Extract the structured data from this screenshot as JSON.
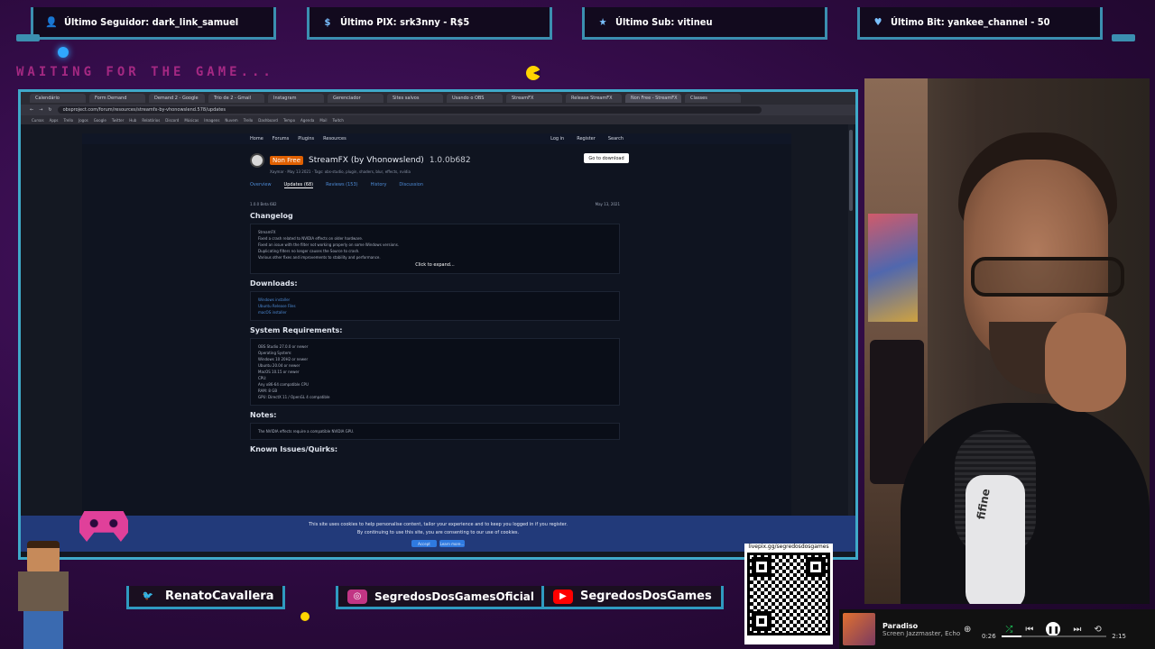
{
  "alerts": [
    {
      "icon": "user-icon",
      "text": "Último Seguidor: dark_link_samuel"
    },
    {
      "icon": "dollar-icon",
      "text": "Último PIX: srk3nny - R$5"
    },
    {
      "icon": "star-icon",
      "text": "Último Sub: vitineu"
    },
    {
      "icon": "heart-icon",
      "text": "Último Bit: yankee_channel - 50"
    }
  ],
  "waiting_text": "WAITING FOR THE GAME...",
  "browser": {
    "tabs": [
      "Calendário",
      "Form Demand",
      "Demand 2 - Google",
      "Trio de 2 - Gmail",
      "Instagram",
      "Gerenciador",
      "Sites salvos",
      "Usando o OBS",
      "StreamFX",
      "Release StreamFX",
      "Non Free - StreamFX",
      "Classes"
    ],
    "url": "obsproject.com/forum/resources/streamfx-by-vhonowslend.578/updates",
    "bookmarks": [
      "Cursos",
      "Apps",
      "Trello",
      "Jogos",
      "Google",
      "Twitter",
      "Hub",
      "Relatórios",
      "Discord",
      "Músicas",
      "Imagens",
      "Nuvem",
      "Trello",
      "Dashboard",
      "Tempo",
      "Agenda",
      "Mail",
      "Twitch"
    ]
  },
  "site": {
    "nav": [
      "Home",
      "Forums",
      "Plugins",
      "Resources"
    ],
    "nav_right": [
      "Log in",
      "Register",
      "Search"
    ],
    "badge": "Non Free",
    "title": "StreamFX (by Vhonowslend)",
    "version": "1.0.0b682",
    "meta": "Xaymar · May 13 2021 · Tags: obs-studio, plugin, shaders, blur, effects, nvidia",
    "download_button": "Go to download",
    "subtabs": [
      "Overview",
      "Updates (68)",
      "Reviews (153)",
      "History",
      "Discussion"
    ],
    "update_tag": "1.0.0 Beta 682",
    "update_date": "May 13, 2021",
    "sections": {
      "changelog_title": "Changelog",
      "changelog_lines": [
        "StreamFX",
        "Fixed a crash related to NVIDIA effects on older hardware.",
        "Fixed an issue with the filter not working properly on some Windows versions.",
        "Duplicating filters no longer causes the Source to crash.",
        "Various other fixes and improvements to stability and performance."
      ],
      "expand": "Click to expand...",
      "downloads_title": "Downloads:",
      "downloads": [
        "Windows installer",
        "Ubuntu Release Files",
        "macOS installer"
      ],
      "requirements_title": "System Requirements:",
      "requirements": [
        "OBS Studio 27.0.0 or newer",
        "Operating System:",
        "Windows 10 20H2 or newer",
        "Ubuntu 20.04 or newer",
        "MacOS 10.15 or newer",
        "CPU:",
        "Any x86-64 compatible CPU",
        "RAM: 8 GB",
        "GPU: DirectX 11 / OpenGL 4 compatible"
      ],
      "notes_title": "Notes:",
      "notes": "The NVIDIA effects require a compatible NVIDIA GPU.",
      "known_title": "Known Issues/Quirks:"
    },
    "cookie_text": "This site uses cookies to help personalise content, tailor your experience and to keep you logged in if you register.",
    "cookie_text2": "By continuing to use this site, you are consenting to our use of cookies.",
    "cookie_accept": "Accept",
    "cookie_learn": "Learn more..."
  },
  "socials": [
    {
      "icon": "twitter-icon",
      "text": "RenatoCavallera",
      "color": "#1da1f2"
    },
    {
      "icon": "instagram-icon",
      "text": "SegredosDosGamesOficial",
      "color": "#c13584"
    },
    {
      "icon": "youtube-icon",
      "text": "SegredosDosGames",
      "color": "#ff0000"
    }
  ],
  "qr_label": "livepix.gg/segredosdosgames",
  "player": {
    "title": "Paradiso",
    "artist": "Screen Jazzmaster, Echo",
    "elapsed": "0:26",
    "total": "2:15",
    "progress": 0.19
  },
  "mic_brand": "fifine"
}
